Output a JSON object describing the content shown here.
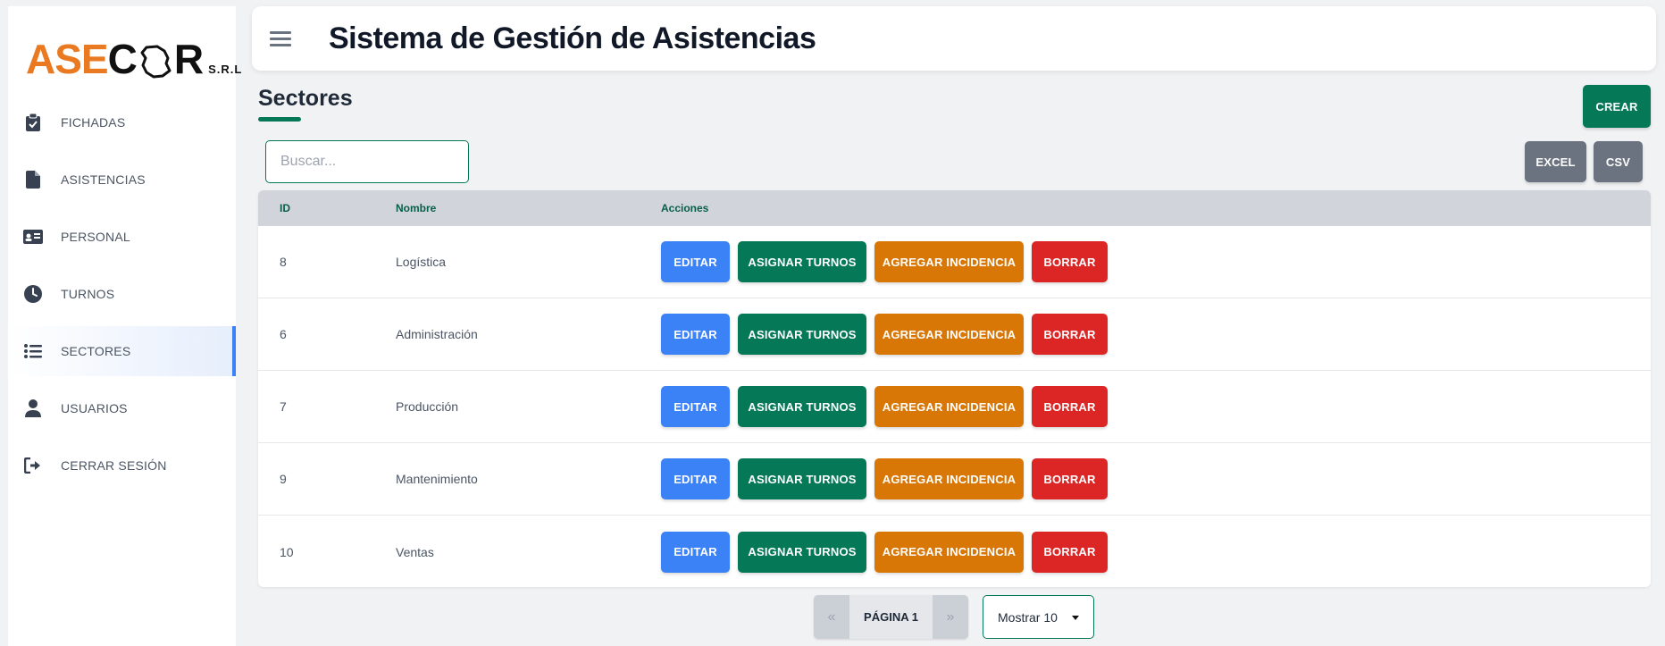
{
  "brand": {
    "part1": "ASE",
    "part2": "C",
    "part3": "R",
    "suffix": "S.R.L",
    "accent": "#ea7a22"
  },
  "sidebar": {
    "items": [
      {
        "label": "FICHADAS",
        "icon": "clipboard-check-icon",
        "active": false
      },
      {
        "label": "ASISTENCIAS",
        "icon": "file-icon",
        "active": false
      },
      {
        "label": "PERSONAL",
        "icon": "id-card-icon",
        "active": false
      },
      {
        "label": "TURNOS",
        "icon": "clock-icon",
        "active": false
      },
      {
        "label": "SECTORES",
        "icon": "list-icon",
        "active": true
      },
      {
        "label": "USUARIOS",
        "icon": "user-icon",
        "active": false
      },
      {
        "label": "CERRAR SESIÓN",
        "icon": "logout-icon",
        "active": false
      }
    ]
  },
  "header": {
    "title": "Sistema de Gestión de Asistencias"
  },
  "page": {
    "title": "Sectores",
    "create_label": "CREAR"
  },
  "search": {
    "placeholder": "Buscar..."
  },
  "export": {
    "excel_label": "EXCEL",
    "csv_label": "CSV"
  },
  "table": {
    "headers": [
      "ID",
      "Nombre",
      "Acciones"
    ],
    "rows": [
      {
        "id": "8",
        "name": "Logística"
      },
      {
        "id": "6",
        "name": "Administración"
      },
      {
        "id": "7",
        "name": "Producción"
      },
      {
        "id": "9",
        "name": "Mantenimiento"
      },
      {
        "id": "10",
        "name": "Ventas"
      }
    ],
    "actions": {
      "edit": "EDITAR",
      "shifts": "ASIGNAR TURNOS",
      "incident": "AGREGAR INCIDENCIA",
      "delete": "BORRAR"
    }
  },
  "pagination": {
    "prev": "«",
    "current": "PÁGINA 1",
    "next": "»",
    "page_size": "Mostrar 10"
  },
  "colors": {
    "primary": "#047857",
    "edit": "#3b82f6",
    "incident": "#d97706",
    "delete": "#dc2626",
    "neutral": "#6b7280"
  }
}
